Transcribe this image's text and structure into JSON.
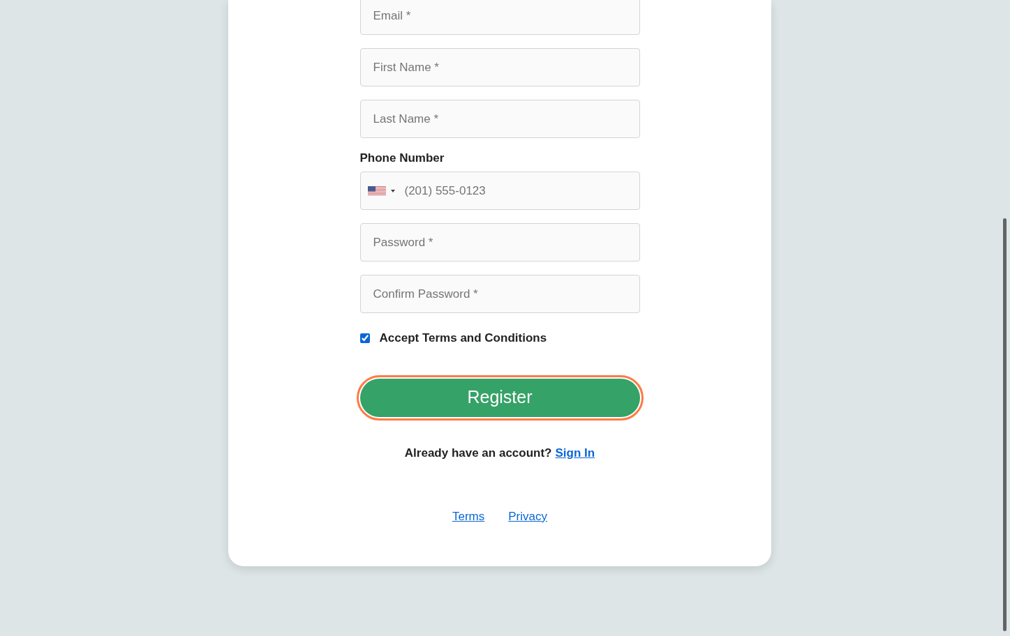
{
  "fields": [
    {
      "kind": "text",
      "placeholder": "Email *"
    },
    {
      "kind": "text",
      "placeholder": "First Name *"
    },
    {
      "kind": "text",
      "placeholder": "Last Name *"
    },
    {
      "kind": "phone",
      "label": "Phone Number",
      "placeholder": "(201) 555-0123"
    },
    {
      "kind": "text",
      "placeholder": "Password *"
    },
    {
      "kind": "text",
      "placeholder": "Confirm Password *"
    }
  ],
  "terms_checkbox": {
    "label": "Accept Terms and Conditions",
    "checked": true
  },
  "register_button": {
    "label": "Register",
    "focused": true
  },
  "signin_prompt": {
    "text": "Already have an account?",
    "link": "Sign In"
  },
  "footer_links": [
    "Terms",
    "Privacy"
  ]
}
